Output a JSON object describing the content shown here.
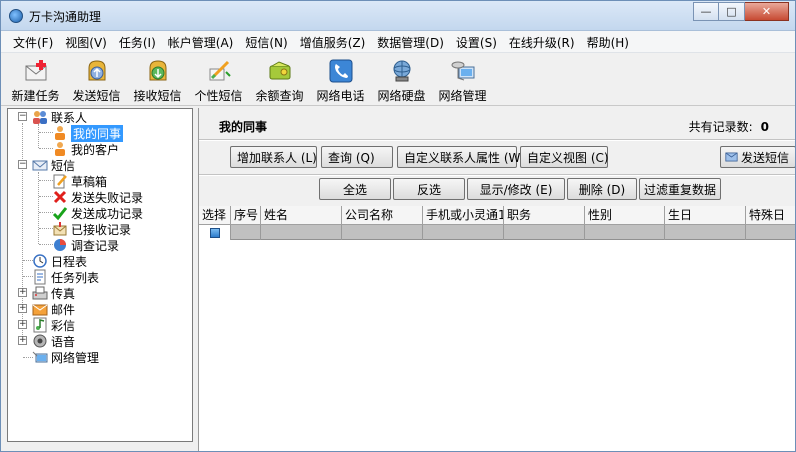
{
  "window": {
    "title": "万卡沟通助理",
    "controls": {
      "minimize": "—",
      "maximize": "□",
      "close": "✕"
    }
  },
  "menu": [
    "文件(F)",
    "视图(V)",
    "任务(I)",
    "帐户管理(A)",
    "短信(N)",
    "增值服务(Z)",
    "数据管理(D)",
    "设置(S)",
    "在线升级(R)",
    "帮助(H)"
  ],
  "toolbar": [
    {
      "label": "新建任务",
      "icon": "new-task-icon"
    },
    {
      "label": "发送短信",
      "icon": "send-sms-icon"
    },
    {
      "label": "接收短信",
      "icon": "receive-sms-icon"
    },
    {
      "label": "个性短信",
      "icon": "personal-sms-icon"
    },
    {
      "label": "余额查询",
      "icon": "balance-icon"
    },
    {
      "label": "网络电话",
      "icon": "phone-icon"
    },
    {
      "label": "网络硬盘",
      "icon": "disk-icon"
    },
    {
      "label": "网络管理",
      "icon": "network-icon"
    }
  ],
  "tree": {
    "contacts": "联系人",
    "colleagues": "我的同事",
    "clients": "我的客户",
    "sms": "短信",
    "drafts": "草稿箱",
    "failed": "发送失败记录",
    "sent": "发送成功记录",
    "received": "已接收记录",
    "survey": "调查记录",
    "schedule": "日程表",
    "tasks": "任务列表",
    "fax": "传真",
    "mail": "邮件",
    "mms": "彩信",
    "voice": "语音",
    "netmgmt": "网络管理"
  },
  "panel": {
    "title": "我的同事",
    "record_count_label": "共有记录数:",
    "record_count": "0",
    "buttons_top": [
      "增加联系人 (L)",
      "查询 (Q)",
      "自定义联系人属性 (W)",
      "自定义视图 (C)"
    ],
    "send_sms_button": "发送短信",
    "buttons_second": [
      "全选",
      "反选",
      "显示/修改 (E)",
      "删除 (D)",
      "过滤重复数据"
    ]
  },
  "grid": {
    "columns": [
      "选择",
      "序号",
      "姓名",
      "公司名称",
      "手机或小灵通1",
      "职务",
      "性别",
      "生日",
      "特殊日"
    ]
  },
  "colors": {
    "selection": "#3399ff",
    "titlebar": "#c3d7ee"
  }
}
